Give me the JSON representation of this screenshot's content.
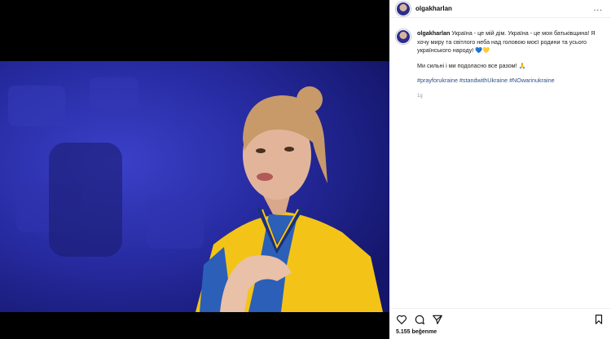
{
  "post": {
    "username": "olgakharlan",
    "more_label": "...",
    "caption_main": "Україна - це мій дім. Україна - це моя батьківщина! Я хочу миру та світлого неба над головою моєї родини та усього українського народу! 💙💛",
    "caption_second": "Ми сильні і ми подоласно все разом! 🙏",
    "hashtags": "#prayforukraine #standwithUkraine #NOwarinukraine",
    "time": "1g",
    "likes": "5.155 beğenme"
  },
  "icons": [
    "heart-icon",
    "comment-icon",
    "share-icon",
    "bookmark-icon"
  ],
  "colors": {
    "photo_bg": "#2a2ea8",
    "hashtag": "#2b4f86",
    "ukraine_blue": "#2b5fb8",
    "ukraine_yellow": "#f3c417"
  }
}
